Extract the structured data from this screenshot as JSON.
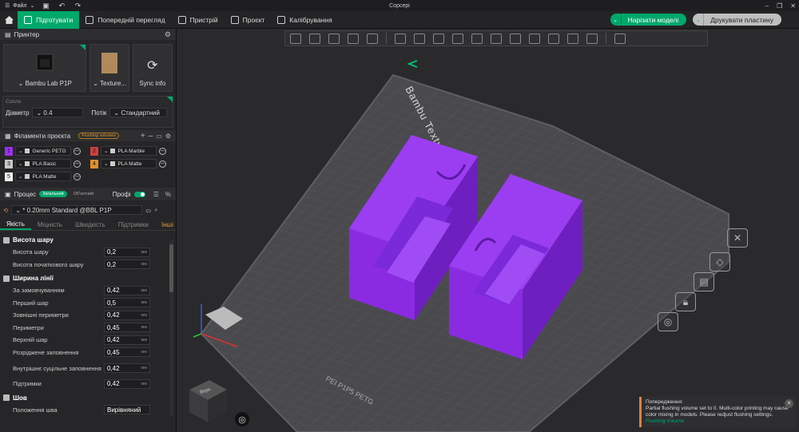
{
  "app": {
    "title": "Copcepi",
    "file_menu": "Файл"
  },
  "nav": {
    "tabs": [
      "Підготувати",
      "Попередній перегляд",
      "Пристрій",
      "Проєкт",
      "Калібрування"
    ],
    "slice_button": "Нарізати моделі",
    "print_button": "Друкувати пластину"
  },
  "printer": {
    "section_title": "Принтер",
    "printer_name": "Bambu Lab P1P",
    "plate_name": "Texture...",
    "sync_label": "Sync info",
    "nozzle_label": "Сопло",
    "diameter_label": "Діаметр",
    "diameter_value": "0.4",
    "flow_label": "Потік",
    "flow_value": "Стандартний"
  },
  "filaments": {
    "section_title": "Філаменти проєкта",
    "badge": "Flushing volumes",
    "items": [
      {
        "num": "1",
        "name": "Generic PETG",
        "color": "#9b30f0"
      },
      {
        "num": "2",
        "name": "PLA Marble",
        "color": "#d04040"
      },
      {
        "num": "3",
        "name": "PLA Basic",
        "color": "#c8c8c8"
      },
      {
        "num": "4",
        "name": "PLA Matte",
        "color": "#e0902a"
      },
      {
        "num": "5",
        "name": "PLA Matte",
        "color": "#f0f0f0"
      }
    ]
  },
  "process": {
    "section_title": "Процес",
    "pill_global": "Загальний",
    "pill_object": "Об'єктний",
    "advanced_label": "Профі",
    "preset": "* 0.20mm Standard @BBL P1P",
    "tabs": [
      "Якість",
      "Міцність",
      "Швидкість",
      "Підтримки",
      "Інші"
    ],
    "groups": [
      {
        "title": "Висота шару",
        "rows": [
          {
            "label": "Висота шару",
            "value": "0,2",
            "unit": "мм"
          },
          {
            "label": "Висота початкового шару",
            "value": "0,2",
            "unit": "мм"
          }
        ]
      },
      {
        "title": "Ширина лінії",
        "rows": [
          {
            "label": "За замовчуванням",
            "value": "0,42",
            "unit": "мм"
          },
          {
            "label": "Перший шар",
            "value": "0,5",
            "unit": "мм"
          },
          {
            "label": "Зовнішні периметри",
            "value": "0,42",
            "unit": "мм"
          },
          {
            "label": "Периметри",
            "value": "0,45",
            "unit": "мм"
          },
          {
            "label": "Верхній шар",
            "value": "0,42",
            "unit": "мм"
          },
          {
            "label": "Розріджене заповнення",
            "value": "0,45",
            "unit": "мм"
          },
          {
            "label": "Внутрішнє суцільне заповнення",
            "value": "0,42",
            "unit": "мм"
          },
          {
            "label": "Підтримки",
            "value": "0,42",
            "unit": "мм"
          }
        ]
      },
      {
        "title": "Шов",
        "rows": [
          {
            "label": "Положення шва",
            "value": "Вирівняний",
            "unit": ""
          }
        ]
      }
    ]
  },
  "viewport": {
    "plate_label": "Bambu Textured PEI Plate",
    "plate_corner_label": "PEI P1P5 PETG",
    "viewcube_label": "Верх"
  },
  "toast": {
    "title": "Попередження:",
    "body": "Partial flushing volume set to 0. Multi-color printing may cause color mixing in models. Please redjust flushing settings.",
    "link": "Flushing Volume"
  },
  "colors": {
    "accent": "#00a86b",
    "model": "#8a2be2",
    "bg": "#2a2a2c"
  }
}
